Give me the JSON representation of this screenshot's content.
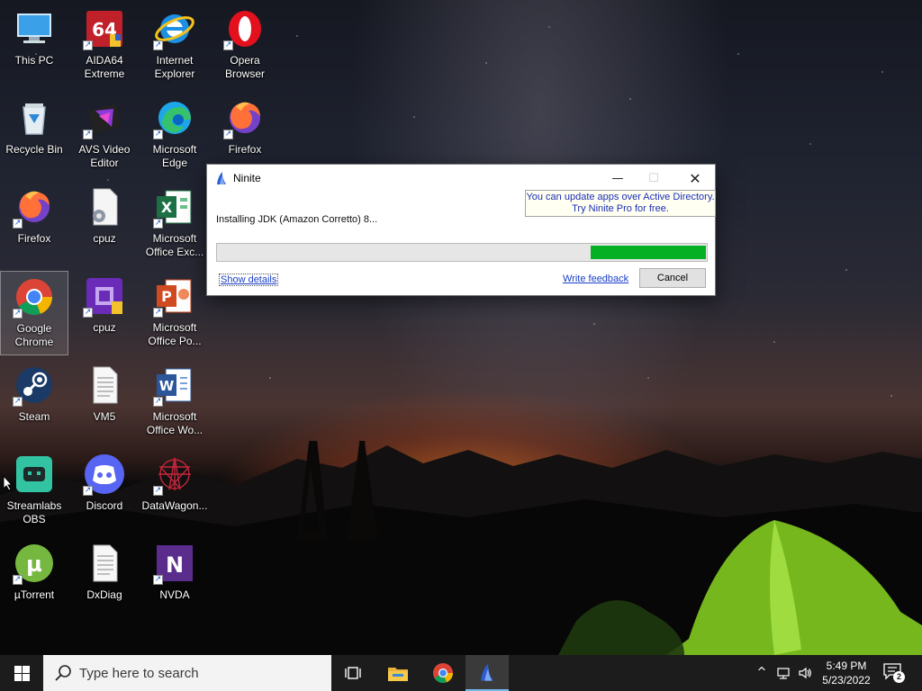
{
  "desktop": {
    "icons": [
      {
        "label": "This PC",
        "icon": "computer-icon"
      },
      {
        "label": "AIDA64\nExtreme",
        "icon": "aida64-icon"
      },
      {
        "label": "Internet\nExplorer",
        "icon": "internet-explorer-icon"
      },
      {
        "label": "Opera\nBrowser",
        "icon": "opera-icon"
      },
      {
        "label": "Recycle Bin",
        "icon": "recycle-bin-icon"
      },
      {
        "label": "AVS Video\nEditor",
        "icon": "avs-video-editor-icon"
      },
      {
        "label": "Microsoft\nEdge",
        "icon": "edge-icon"
      },
      {
        "label": "Firefox",
        "icon": "firefox-icon"
      },
      {
        "label": "Firefox",
        "icon": "firefox-icon"
      },
      {
        "label": "cpuz",
        "icon": "file-gear-icon"
      },
      {
        "label": "Microsoft\nOffice Exc...",
        "icon": "excel-icon"
      },
      {
        "label": "Google\nChrome",
        "icon": "chrome-icon"
      },
      {
        "label": "cpuz",
        "icon": "cpuz-icon"
      },
      {
        "label": "Microsoft\nOffice Po...",
        "icon": "powerpoint-icon"
      },
      {
        "label": "Steam",
        "icon": "steam-icon"
      },
      {
        "label": "VM5",
        "icon": "text-file-icon"
      },
      {
        "label": "Microsoft\nOffice Wo...",
        "icon": "word-icon"
      },
      {
        "label": "Streamlabs\nOBS",
        "icon": "streamlabs-icon"
      },
      {
        "label": "Discord",
        "icon": "discord-icon"
      },
      {
        "label": "DataWagon...",
        "icon": "datawagon-icon"
      },
      {
        "label": "µTorrent",
        "icon": "utorrent-icon"
      },
      {
        "label": "DxDiag",
        "icon": "text-file-icon"
      },
      {
        "label": "NVDA",
        "icon": "nvda-icon"
      }
    ]
  },
  "ninite": {
    "title": "Ninite",
    "promo_line1": "You can update apps over Active Directory.",
    "promo_line2": "Try Ninite Pro for free.",
    "status": "Installing JDK (Amazon Corretto) 8...",
    "progress_start": 0.76,
    "progress_end": 0.995,
    "show_details": "Show details",
    "write_feedback": "Write feedback",
    "cancel": "Cancel",
    "minimize_glyph": "—",
    "maximize_glyph": "☐",
    "close_glyph": "✕"
  },
  "taskbar": {
    "search_placeholder": "Type here to search",
    "time": "5:49 PM",
    "date": "5/23/2022",
    "notification_count": "2",
    "pinned": [
      "task-view-icon",
      "file-explorer-icon",
      "chrome-icon",
      "ninite-icon"
    ],
    "tray": [
      "chevron-up-icon",
      "network-icon",
      "volume-icon"
    ]
  },
  "colors": {
    "progress": "#06b025",
    "promo_text": "#1b2fb5",
    "taskbar": "#1c1c1c",
    "link": "#1a3fc7"
  }
}
